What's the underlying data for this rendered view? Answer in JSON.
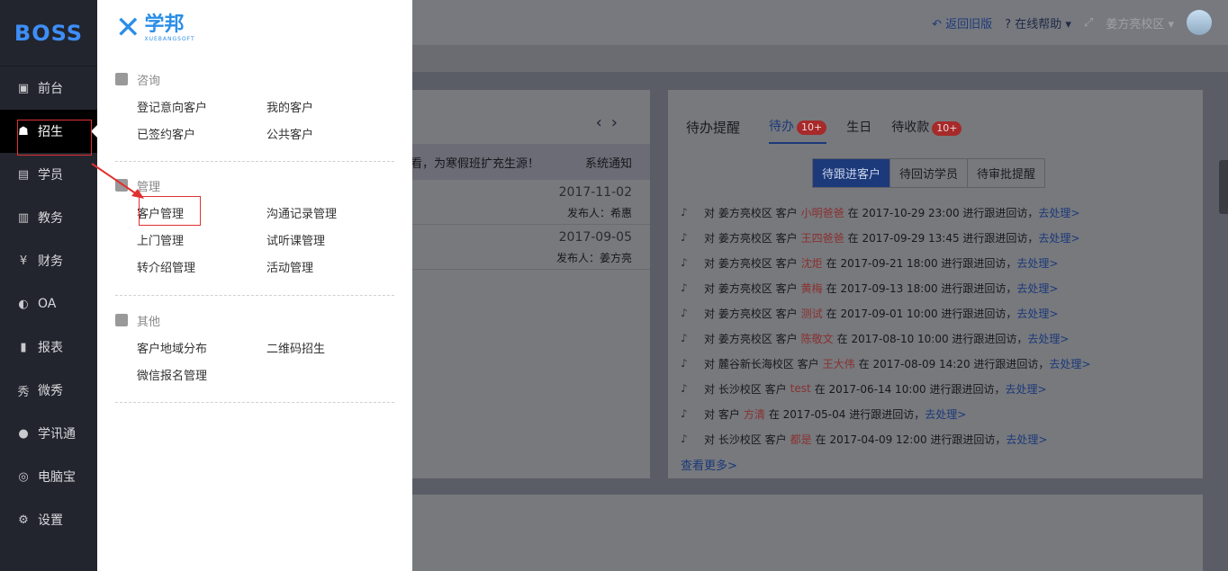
{
  "sidebar": {
    "logo": "BOSS",
    "items": [
      {
        "label": "前台",
        "icon": "calendar-icon"
      },
      {
        "label": "招生",
        "icon": "user-add-icon"
      },
      {
        "label": "学员",
        "icon": "id-card-icon"
      },
      {
        "label": "教务",
        "icon": "book-icon"
      },
      {
        "label": "财务",
        "icon": "yen-icon"
      },
      {
        "label": "OA",
        "icon": "toggle-icon"
      },
      {
        "label": "报表",
        "icon": "bar-chart-icon"
      },
      {
        "label": "微秀",
        "icon": "xiu-icon"
      },
      {
        "label": "学讯通",
        "icon": "location-icon"
      },
      {
        "label": "电脑宝",
        "icon": "coin-icon"
      },
      {
        "label": "设置",
        "icon": "gear-icon"
      }
    ]
  },
  "topbar": {
    "back_label": "返回旧版",
    "help_label": "在线帮助",
    "campus_label": "姜方亮校区"
  },
  "dropdown": {
    "logo_cn": "学邦",
    "logo_en": "XUEBANGSOFT",
    "sections": [
      {
        "title": "咨询",
        "items": [
          "登记意向客户",
          "我的客户",
          "已签约客户",
          "公共客户"
        ]
      },
      {
        "title": "管理",
        "items": [
          "客户管理",
          "沟通记录管理",
          "上门管理",
          "试听课管理",
          "转介绍管理",
          "活动管理"
        ]
      },
      {
        "title": "其他",
        "items": [
          "客户地域分布",
          "二维码招生",
          "微信报名管理"
        ]
      }
    ]
  },
  "notice_panel": {
    "notice_text": "看，为寒假班扩充生源！",
    "notice_type": "系统通知",
    "rows": [
      {
        "date": "2017-11-02",
        "publisher": "发布人：希惠"
      },
      {
        "date": "2017-09-05",
        "publisher": "发布人：姜方亮"
      }
    ]
  },
  "todo_panel": {
    "title": "待办提醒",
    "tabs": [
      {
        "label": "待办",
        "badge": "10+"
      },
      {
        "label": "生日",
        "badge": ""
      },
      {
        "label": "待收款",
        "badge": "10+"
      }
    ],
    "segments": [
      "待跟进客户",
      "待回访学员",
      "待审批提醒"
    ],
    "items": [
      {
        "pre": "对 姜方亮校区 客户",
        "name": "小明爸爸",
        "post": "在 2017-10-29 23:00 进行跟进回访，",
        "action": "去处理>"
      },
      {
        "pre": "对 姜方亮校区 客户",
        "name": "王四爸爸",
        "post": "在 2017-09-29 13:45 进行跟进回访，",
        "action": "去处理>"
      },
      {
        "pre": "对 姜方亮校区 客户",
        "name": "沈炬",
        "post": "在 2017-09-21 18:00 进行跟进回访，",
        "action": "去处理>"
      },
      {
        "pre": "对 姜方亮校区 客户",
        "name": "黄梅",
        "post": "在 2017-09-13 18:00 进行跟进回访，",
        "action": "去处理>"
      },
      {
        "pre": "对 姜方亮校区 客户",
        "name": "测试",
        "post": "在 2017-09-01 10:00 进行跟进回访，",
        "action": "去处理>"
      },
      {
        "pre": "对 姜方亮校区 客户",
        "name": "陈敬文",
        "post": "在 2017-08-10 10:00 进行跟进回访，",
        "action": "去处理>"
      },
      {
        "pre": "对 麓谷新长海校区 客户",
        "name": "王大伟",
        "post": "在 2017-08-09 14:20 进行跟进回访，",
        "action": "去处理>"
      },
      {
        "pre": "对 长沙校区 客户",
        "name": "test",
        "post": "在 2017-06-14 10:00 进行跟进回访，",
        "action": "去处理>"
      },
      {
        "pre": "对 客户",
        "name": "方清",
        "post": "在 2017-05-04 进行跟进回访，",
        "action": "去处理>"
      },
      {
        "pre": "对 长沙校区 客户",
        "name": "都是",
        "post": "在 2017-04-09 12:00 进行跟进回访，",
        "action": "去处理>"
      }
    ],
    "more": "查看更多>"
  }
}
